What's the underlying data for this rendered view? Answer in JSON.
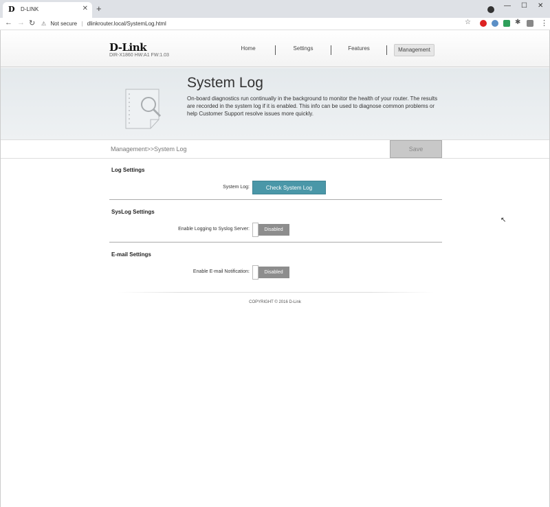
{
  "browser": {
    "tab_title": "D-LINK",
    "tab_favicon": "D",
    "new_tab": "+",
    "security_label": "Not secure",
    "url": "dlinkrouter.local/SystemLog.html"
  },
  "header": {
    "logo": "D-Link",
    "hw_info": "DIR-X1860 HW:A1 FW:1.03",
    "nav": [
      "Home",
      "Settings",
      "Features",
      "Management"
    ],
    "active_nav": "Management"
  },
  "hero": {
    "title": "System Log",
    "description": "On-board diagnostics run continually in the background to monitor the health of your router. The results are recorded in the system log if it is enabled. This info can be used to diagnose common problems or help Customer Support resolve issues more quickly."
  },
  "breadcrumb": "Management>>System Log",
  "save_label": "Save",
  "sections": {
    "log": {
      "title": "Log Settings",
      "label": "System Log:",
      "button": "Check System Log"
    },
    "syslog": {
      "title": "SysLog Settings",
      "label": "Enable Logging to Syslog Server:",
      "toggle": "Disabled"
    },
    "email": {
      "title": "E-mail Settings",
      "label": "Enable E-mail Notification:",
      "toggle": "Disabled"
    }
  },
  "footer": "COPYRIGHT © 2016 D-Link",
  "colors": {
    "accent": "#4a97a8",
    "toggle_off": "#8d8d8d"
  }
}
